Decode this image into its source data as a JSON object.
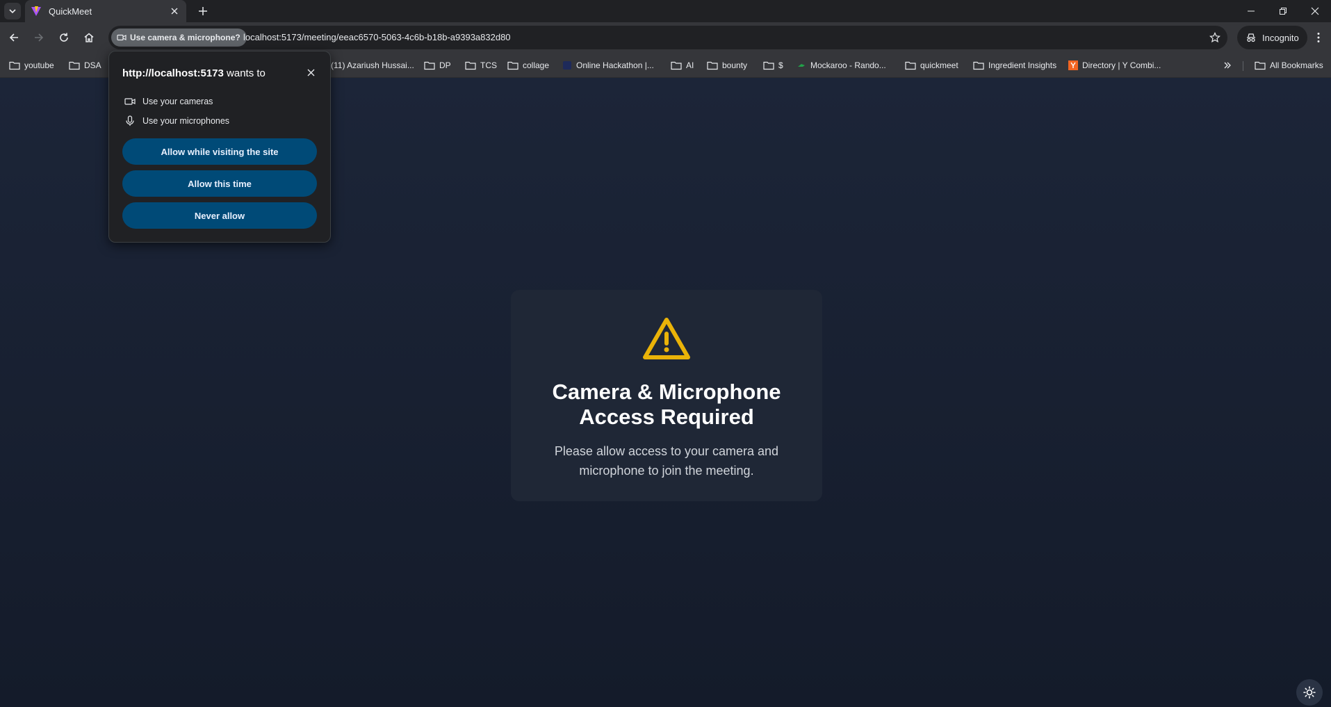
{
  "browser": {
    "tab": {
      "title": "QuickMeet"
    },
    "omnibox": {
      "permission_chip": "Use camera & microphone?",
      "url": "localhost:5173/meeting/eeac6570-5063-4c6b-b18b-a9393a832d80"
    },
    "incognito_label": "Incognito",
    "bookmarks": [
      {
        "label": "youtube",
        "icon": "folder-icon"
      },
      {
        "label": "DSA",
        "icon": "folder-icon"
      },
      {
        "label": "(11) Azariush Hussai...",
        "icon": "none"
      },
      {
        "label": "DP",
        "icon": "folder-icon"
      },
      {
        "label": "TCS",
        "icon": "folder-icon"
      },
      {
        "label": "collage",
        "icon": "folder-icon"
      },
      {
        "label": "Online Hackathon |...",
        "icon": "site-icon"
      },
      {
        "label": "AI",
        "icon": "folder-icon"
      },
      {
        "label": "bounty",
        "icon": "folder-icon"
      },
      {
        "label": "$",
        "icon": "folder-icon"
      },
      {
        "label": "Mockaroo - Rando...",
        "icon": "mockaroo-icon"
      },
      {
        "label": "quickmeet",
        "icon": "folder-icon"
      },
      {
        "label": "Ingredient Insights",
        "icon": "folder-icon"
      },
      {
        "label": "Directory | Y Combi...",
        "icon": "ycombinator-icon"
      }
    ],
    "all_bookmarks_label": "All Bookmarks"
  },
  "permission_popup": {
    "origin": "http://localhost:5173",
    "suffix": " wants to",
    "items": [
      {
        "label": "Use your cameras",
        "icon": "camera-icon"
      },
      {
        "label": "Use your microphones",
        "icon": "microphone-icon"
      }
    ],
    "buttons": {
      "allow_site": "Allow while visiting the site",
      "allow_once": "Allow this time",
      "never": "Never allow"
    }
  },
  "page": {
    "card": {
      "title": "Camera & Microphone Access Required",
      "message": "Please allow access to your camera and microphone to join the meeting.",
      "icon": "warning-triangle-icon"
    },
    "theme_toggle_icon": "sun-icon"
  },
  "colors": {
    "page_background": "#1c2538",
    "card_background": "#1f2736",
    "warning": "#eab308",
    "button": "#004a77"
  }
}
